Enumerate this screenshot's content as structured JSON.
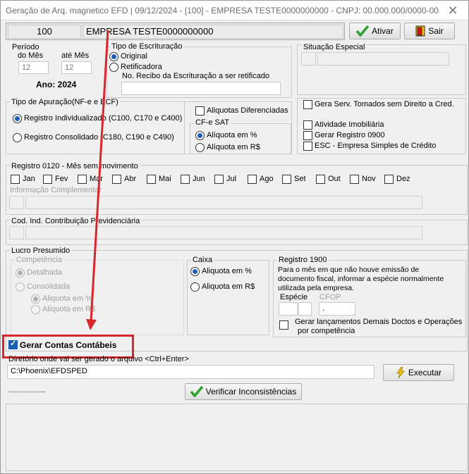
{
  "window": {
    "title": "Geração de Arq. magnetico EFD |  09/12/2024 - [100] - EMPRESA TESTE0000000000 - CNPJ: 00.000.000/0000-00",
    "close_glyph": "✕"
  },
  "company": {
    "code": "100",
    "name": "EMPRESA TESTE0000000000"
  },
  "buttons": {
    "ativar": "Ativar",
    "sair": "Sair",
    "executar": "Executar",
    "verificar": "Verificar Inconsistências"
  },
  "periodo": {
    "legend": "Período",
    "do_mes_label": "do Mês",
    "ate_mes_label": "até Mês",
    "do_mes": "12",
    "ate_mes": "12",
    "ano": "Ano: 2024"
  },
  "tipo_escrituracao": {
    "legend": "Tipo de Escrituração",
    "original": "Original",
    "retificadora": "Retificadora",
    "recibo_label": "No. Recibo da Escrituração a ser retificado",
    "recibo_value": ""
  },
  "situacao_especial": {
    "legend": "Situação Especial"
  },
  "tipo_apuracao": {
    "legend": "Tipo de Apuração(NF-e e ECF)",
    "individualizado": "Registro Individualizado (C100, C170 e C400)",
    "consolidado": "Registro Consolidado (C180, C190 e C490)"
  },
  "aliquotas_diferenciadas": "Aliquotas Diferenciadas",
  "cfe_sat": {
    "legend": "CF-e SAT",
    "percent": "Alíquota em %",
    "reais": "Alíquota em R$"
  },
  "options": {
    "gera_serv": "Gera Serv. Tomados sem Direito a Cred.",
    "atividade_imobiliaria": "Atividade Imobiliária",
    "gerar_registro_0900": "Gerar Registro 0900",
    "esc": "ESC - Empresa Simples de Crédito"
  },
  "registro_0120": {
    "legend": "Registro 0120 - Mês sem movimento",
    "months": [
      "Jan",
      "Fev",
      "Mar",
      "Abr",
      "Mai",
      "Jun",
      "Jul",
      "Ago",
      "Set",
      "Out",
      "Nov",
      "Dez"
    ],
    "info_label": "Informação Complementar"
  },
  "cod_ind": {
    "legend": "Cod. Ind. Contribuição Previdenciária"
  },
  "lucro_presumido": {
    "legend": "Lucro Presumido",
    "competencia": "Competência",
    "detalhada": "Detalhada",
    "consolidada": "Consolidada",
    "percent": "Aliquota em %",
    "reais": "Aliquota em R$"
  },
  "caixa": {
    "legend": "Caixa",
    "percent": "Aliquota em %",
    "reais": "Aliquota em R$"
  },
  "registro_1900": {
    "legend": "Registro 1900",
    "text_line1": "Para o mês em que não houve emissão de",
    "text_line2": "documento fiscal, informar a espécie normalmente",
    "text_line3": "utilizada pela empresa.",
    "especie_label": "Espécie",
    "cfop_label": "CFOP",
    "cfop_value": ".",
    "gerar_lanc_line1": "Gerar lançamentos Demais Doctos e Operações",
    "gerar_lanc_line2": "por competência"
  },
  "gerar_contas": "Gerar Contas Contábeis",
  "diretorio": {
    "label": "Diretório onde  vai ser gerado o  arquivo <Ctrl+Enter>",
    "value": "C:\\Phoenix\\EFDSPED"
  },
  "dots": "...................",
  "annotation": {
    "highlight_color": "#d9262c"
  }
}
